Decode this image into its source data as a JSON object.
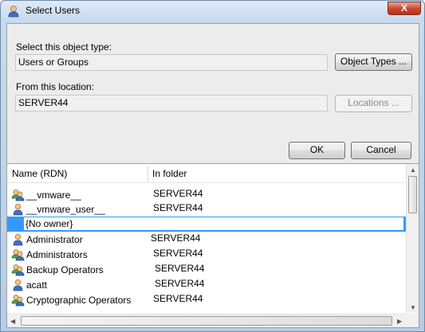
{
  "window": {
    "title": "Select Users",
    "close_label": "X"
  },
  "object_type": {
    "label": "Select this object type:",
    "value": "Users or Groups",
    "button": "Object Types ..."
  },
  "location": {
    "label": "From this location:",
    "value": "SERVER44",
    "button": "Locations ..."
  },
  "actions": {
    "ok": "OK",
    "cancel": "Cancel"
  },
  "list": {
    "columns": [
      "Name (RDN)",
      "In folder"
    ],
    "rows": [
      {
        "name": "__vmware__",
        "folder": "SERVER44",
        "icon": "group-icon"
      },
      {
        "name": "__vmware_user__",
        "folder": "SERVER44",
        "icon": "user-icon"
      },
      {
        "name": "{No owner}",
        "folder": "",
        "icon": "",
        "selected": true
      },
      {
        "name": "Administrator",
        "folder": "SERVER44",
        "icon": "user-icon"
      },
      {
        "name": "Administrators",
        "folder": "SERVER44",
        "icon": "group-icon"
      },
      {
        "name": "Backup Operators",
        "folder": "SERVER44",
        "icon": "group-icon"
      },
      {
        "name": "acatt",
        "folder": "SERVER44",
        "icon": "user-icon"
      },
      {
        "name": "Cryptographic Operators",
        "folder": "SERVER44",
        "icon": "group-icon"
      }
    ]
  }
}
